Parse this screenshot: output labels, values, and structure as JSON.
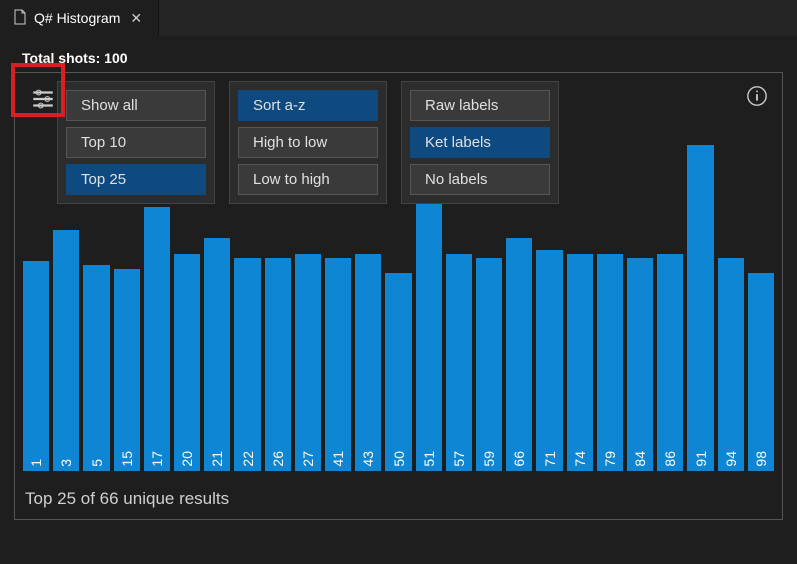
{
  "tab": {
    "title": "Q# Histogram"
  },
  "header": {
    "total_shots": "Total shots: 100"
  },
  "filters": {
    "group1": [
      {
        "label": "Show all",
        "active": false
      },
      {
        "label": "Top 10",
        "active": false
      },
      {
        "label": "Top 25",
        "active": true
      }
    ],
    "group2": [
      {
        "label": "Sort a-z",
        "active": true
      },
      {
        "label": "High to low",
        "active": false
      },
      {
        "label": "Low to high",
        "active": false
      }
    ],
    "group3": [
      {
        "label": "Raw labels",
        "active": false
      },
      {
        "label": "Ket labels",
        "active": true
      },
      {
        "label": "No labels",
        "active": false
      }
    ]
  },
  "summary": "Top 25 of 66 unique results",
  "chart_data": {
    "type": "bar",
    "title": "Q# Histogram",
    "xlabel": "",
    "ylabel": "",
    "ylim": [
      0,
      100
    ],
    "categories": [
      "1",
      "3",
      "5",
      "15",
      "17",
      "20",
      "21",
      "22",
      "26",
      "27",
      "41",
      "43",
      "50",
      "51",
      "57",
      "59",
      "66",
      "71",
      "74",
      "79",
      "84",
      "86",
      "91",
      "94",
      "98"
    ],
    "values": [
      54,
      62,
      53,
      52,
      68,
      56,
      60,
      55,
      55,
      56,
      55,
      56,
      51,
      69,
      56,
      55,
      60,
      57,
      56,
      56,
      55,
      56,
      84,
      55,
      51
    ]
  }
}
